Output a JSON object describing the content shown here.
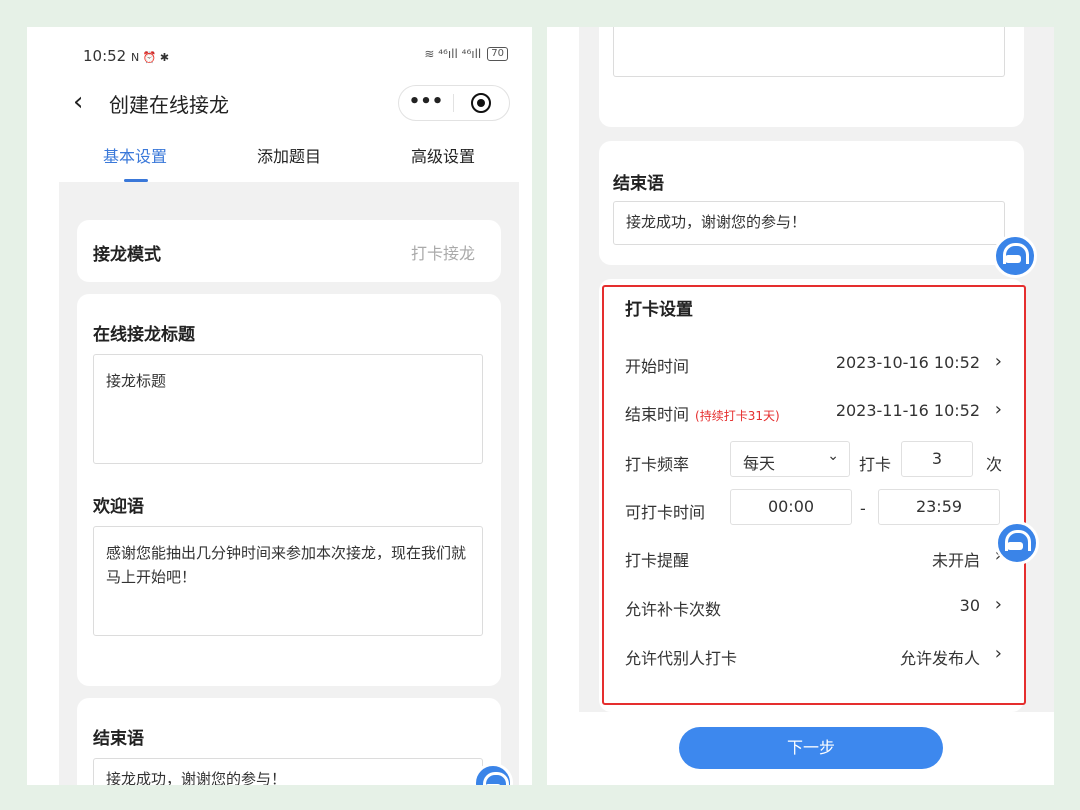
{
  "left": {
    "status": {
      "time": "10:52",
      "icons": "N ⏰ ✱",
      "signal": "≋ ⁴⁶ıll ⁴⁶ıll",
      "battery": "70"
    },
    "nav": {
      "title": "创建在线接龙",
      "more": "•••"
    },
    "tabs": [
      {
        "label": "基本设置"
      },
      {
        "label": "添加题目"
      },
      {
        "label": "高级设置"
      }
    ],
    "mode": {
      "label": "接龙模式",
      "value": "打卡接龙"
    },
    "title_section": {
      "label": "在线接龙标题",
      "placeholder": "接龙标题"
    },
    "welcome": {
      "label": "欢迎语",
      "text": "感谢您能抽出几分钟时间来参加本次接龙，现在我们就马上开始吧！"
    },
    "ending": {
      "label": "结束语",
      "text": "接龙成功，谢谢您的参与！"
    }
  },
  "right": {
    "ending": {
      "label": "结束语",
      "text": "接龙成功，谢谢您的参与！"
    },
    "checkin": {
      "title": "打卡设置",
      "start": {
        "label": "开始时间",
        "value": "2023-10-16 10:52"
      },
      "end": {
        "label": "结束时间",
        "note": "(持续打卡31天)",
        "value": "2023-11-16 10:52"
      },
      "freq": {
        "label": "打卡频率",
        "select": "每天",
        "mid": "打卡",
        "count": "3",
        "unit": "次"
      },
      "time_range": {
        "label": "可打卡时间",
        "from": "00:00",
        "sep": "-",
        "to": "23:59"
      },
      "reminder": {
        "label": "打卡提醒",
        "value": "未开启"
      },
      "makeup": {
        "label": "允许补卡次数",
        "value": "30"
      },
      "proxy": {
        "label": "允许代别人打卡",
        "value": "允许发布人"
      }
    },
    "next_button": "下一步"
  }
}
